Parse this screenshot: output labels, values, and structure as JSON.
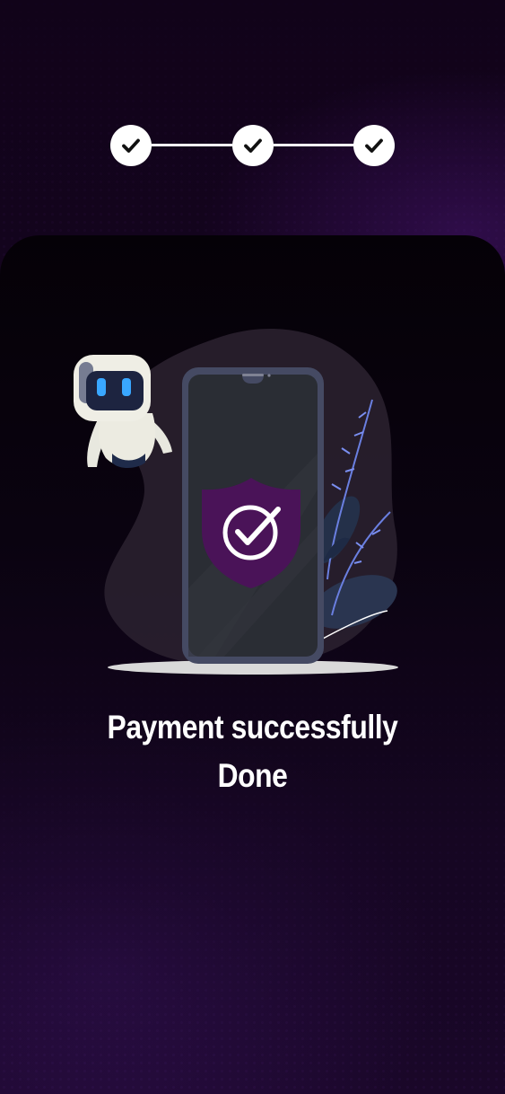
{
  "stepper": {
    "steps": [
      {
        "status": "completed",
        "icon": "check-icon"
      },
      {
        "status": "completed",
        "icon": "check-icon"
      },
      {
        "status": "completed",
        "icon": "check-icon"
      }
    ]
  },
  "illustration": {
    "icons": [
      "robot-icon",
      "phone-icon",
      "shield-check-icon",
      "plant-icon"
    ]
  },
  "message": {
    "line1": "Payment successfully",
    "line2": "Done"
  },
  "colors": {
    "background": "#150420",
    "accent": "#4a1358",
    "text": "#ffffff"
  }
}
